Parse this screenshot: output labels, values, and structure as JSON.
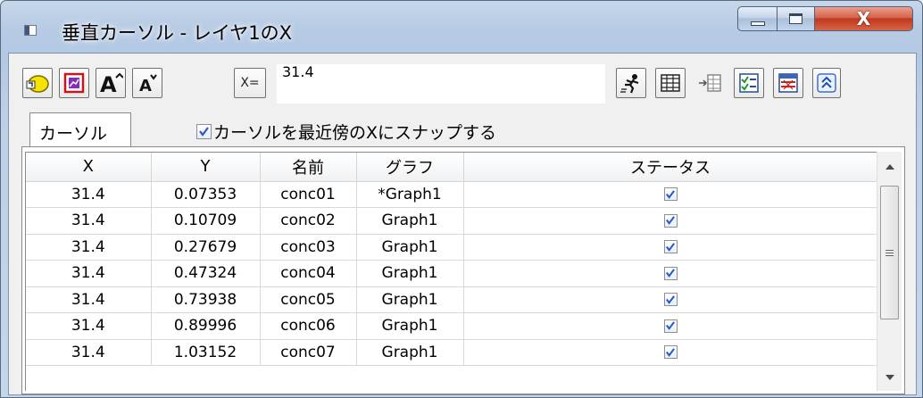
{
  "window": {
    "title": "垂直カーソル - レイヤ1のX",
    "buttons": {
      "minimize_icon": "minimize-icon",
      "maximize_icon": "maximize-icon",
      "close_icon": "close-icon",
      "close_glyph": "X"
    }
  },
  "toolbar": {
    "left_buttons": [
      {
        "icon": "cursor-hand-icon"
      },
      {
        "icon": "delete-plot-icon"
      },
      {
        "icon": "increase-font-icon"
      },
      {
        "icon": "decrease-font-icon"
      },
      {
        "icon": "x-equals-icon",
        "glyph": "X="
      }
    ],
    "x_value": "31.4",
    "right_buttons": [
      {
        "icon": "runner-icon"
      },
      {
        "icon": "table-columns-icon"
      },
      {
        "icon": "add-to-worksheet-icon"
      },
      {
        "icon": "checklist-icon"
      },
      {
        "icon": "export-table-icon"
      },
      {
        "icon": "collapse-up-icon"
      }
    ]
  },
  "tabs": [
    {
      "label": "カーソル",
      "active": true
    }
  ],
  "snap_option": {
    "label": "カーソルを最近傍のXにスナップする",
    "checked": true
  },
  "table": {
    "columns": [
      "X",
      "Y",
      "名前",
      "グラフ",
      "ステータス"
    ],
    "rows": [
      {
        "x": "31.4",
        "y": "0.07353",
        "name": "conc01",
        "graph": "*Graph1",
        "status": true
      },
      {
        "x": "31.4",
        "y": "0.10709",
        "name": "conc02",
        "graph": "Graph1",
        "status": true
      },
      {
        "x": "31.4",
        "y": "0.27679",
        "name": "conc03",
        "graph": "Graph1",
        "status": true
      },
      {
        "x": "31.4",
        "y": "0.47324",
        "name": "conc04",
        "graph": "Graph1",
        "status": true
      },
      {
        "x": "31.4",
        "y": "0.73938",
        "name": "conc05",
        "graph": "Graph1",
        "status": true
      },
      {
        "x": "31.4",
        "y": "0.89996",
        "name": "conc06",
        "graph": "Graph1",
        "status": true
      },
      {
        "x": "31.4",
        "y": "1.03152",
        "name": "conc07",
        "graph": "Graph1",
        "status": true
      }
    ]
  },
  "colors": {
    "accent": "#3a6fd1",
    "close": "#c7432a",
    "titlebar": "#b7cbe4"
  }
}
